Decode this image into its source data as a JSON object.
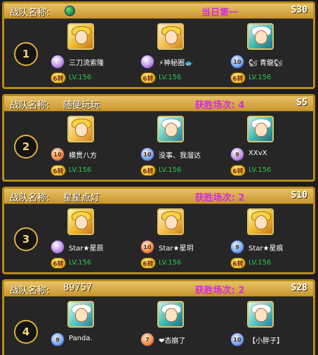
{
  "header_label": "战队名称:",
  "teams": [
    {
      "rank": "1",
      "name": "",
      "stat": "当日第一",
      "server": "S30",
      "members": [
        {
          "name": "三刀流索隆",
          "sign": "6转",
          "level": "LV.156",
          "badge": ""
        },
        {
          "name": "⚡神秘圈🐟",
          "sign": "6转",
          "level": "LV.156",
          "badge": ""
        },
        {
          "name": "🐿 青龍🐿",
          "sign": "6转",
          "level": "LV.156",
          "badge": "10"
        }
      ]
    },
    {
      "rank": "2",
      "name": "随便玩玩",
      "stat": "获胜场次: 4",
      "server": "S5",
      "members": [
        {
          "name": "横贯八方",
          "sign": "6转",
          "level": "LV.156",
          "badge": "10"
        },
        {
          "name": "没事、我溜达",
          "sign": "6转",
          "level": "LV.156",
          "badge": "10"
        },
        {
          "name": "XXvX",
          "sign": "6转",
          "level": "LV.156",
          "badge": "9"
        }
      ]
    },
    {
      "rank": "3",
      "name": "星星点灯",
      "stat": "获胜场次: 2",
      "server": "S10",
      "members": [
        {
          "name": "Star★星辰",
          "sign": "6转",
          "level": "LV.156",
          "badge": ""
        },
        {
          "name": "Star★星玥",
          "sign": "6转",
          "level": "LV.156",
          "badge": "10"
        },
        {
          "name": "Star★星痕",
          "sign": "6转",
          "level": "LV.156",
          "badge": "9"
        }
      ]
    },
    {
      "rank": "4",
      "name": "89757",
      "stat": "获胜场次: 2",
      "server": "S28",
      "members": [
        {
          "name": "Panda.",
          "sign": "",
          "level": "",
          "badge": "9"
        },
        {
          "name": "❤态崩了",
          "sign": "",
          "level": "",
          "badge": "7"
        },
        {
          "name": "【小胖子】",
          "sign": "",
          "level": "",
          "badge": "10"
        }
      ]
    }
  ]
}
